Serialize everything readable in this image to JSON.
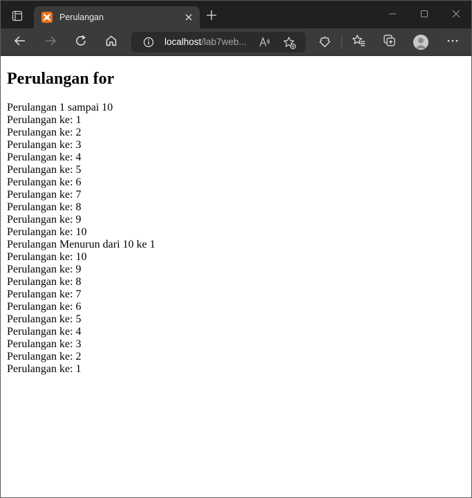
{
  "browser": {
    "tab": {
      "title": "Perulangan",
      "favicon_color": "#e8701d"
    },
    "address_bar": {
      "host": "localhost",
      "path": "/lab7web..."
    },
    "icons": {
      "tab_actions": "tab-actions-icon",
      "new_tab": "plus-icon",
      "back": "arrow-left-icon",
      "forward": "arrow-right-icon",
      "refresh": "refresh-icon",
      "home": "home-icon",
      "site_info": "info-icon",
      "read_aloud": "read-aloud-icon",
      "add_favorite": "star-add-icon",
      "extensions": "puzzle-icon",
      "favorites": "favorites-icon",
      "collections": "collections-icon",
      "profile": "profile-icon",
      "menu": "more-icon"
    },
    "colors": {
      "tabstrip_bg": "#202020",
      "toolbar_bg": "#3b3b3b",
      "omnibox_bg": "#2b2b2b"
    }
  },
  "page": {
    "heading": "Perulangan for",
    "lines": [
      "Perulangan 1 sampai 10",
      "Perulangan ke: 1",
      "Perulangan ke: 2",
      "Perulangan ke: 3",
      "Perulangan ke: 4",
      "Perulangan ke: 5",
      "Perulangan ke: 6",
      "Perulangan ke: 7",
      "Perulangan ke: 8",
      "Perulangan ke: 9",
      "Perulangan ke: 10",
      "Perulangan Menurun dari 10 ke 1",
      "Perulangan ke: 10",
      "Perulangan ke: 9",
      "Perulangan ke: 8",
      "Perulangan ke: 7",
      "Perulangan ke: 6",
      "Perulangan ke: 5",
      "Perulangan ke: 4",
      "Perulangan ke: 3",
      "Perulangan ke: 2",
      "Perulangan ke: 1"
    ]
  }
}
